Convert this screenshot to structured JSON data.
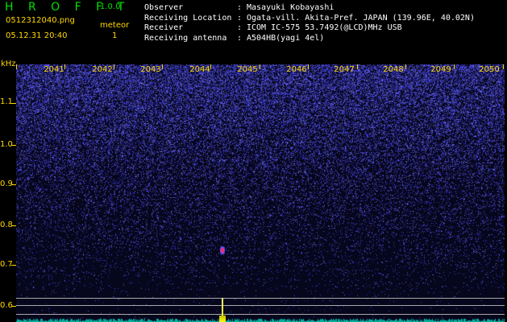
{
  "app": {
    "title": "H R O F F T",
    "version": "1.0.0"
  },
  "file": {
    "name": "0512312040.png",
    "datetime": "05.12.31 20:40"
  },
  "meteor": {
    "label": "meteor",
    "count": "1"
  },
  "info": [
    {
      "key": "Observer",
      "value": "Masayuki Kobayashi"
    },
    {
      "key": "Receiving Location",
      "value": "Ogata-vill. Akita-Pref. JAPAN (139.96E, 40.02N)"
    },
    {
      "key": "Receiver",
      "value": "ICOM IC-575 53.7492(@LCD)MHz USB"
    },
    {
      "key": "Receiving antenna",
      "value": "A504HB(yagi 4el)"
    }
  ],
  "axis": {
    "unit": "kHz",
    "y_labels": [
      "1.1",
      "1.0",
      "0.9",
      "0.8",
      "0.7",
      "0.6"
    ],
    "x_labels": [
      "2041",
      "2042",
      "2043",
      "2044",
      "2045",
      "2046",
      "2047",
      "2048",
      "2049",
      "2050"
    ]
  },
  "colors": {
    "header_green": "#00e000",
    "label_yellow": "#ffd800",
    "noise_blue": "#3a3aff",
    "meteor_red": "#ff2a6a",
    "spike_yellow": "#ffff00"
  }
}
